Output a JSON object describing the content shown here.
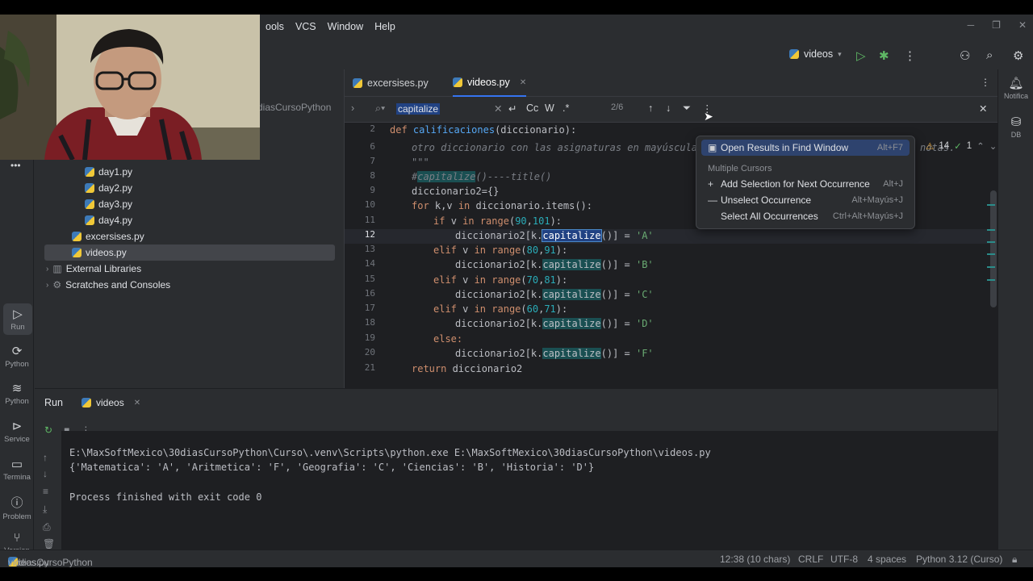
{
  "menu": [
    "ools",
    "VCS",
    "Window",
    "Help"
  ],
  "toolbar": {
    "run_config": "videos"
  },
  "tabs": [
    {
      "label": "excersises.py"
    },
    {
      "label": "videos.py"
    }
  ],
  "project": {
    "root_fragment": "diasCursoPython",
    "items": [
      {
        "label": "day1.py"
      },
      {
        "label": "day2.py"
      },
      {
        "label": "day3.py"
      },
      {
        "label": "day4.py"
      },
      {
        "label": "excersises.py"
      },
      {
        "label": "videos.py"
      },
      {
        "label": "External Libraries"
      },
      {
        "label": "Scratches and Consoles"
      }
    ]
  },
  "find": {
    "query": "capitalize",
    "match_count": "2/6",
    "case_label": "Cc",
    "word_label": "W",
    "regex_label": ".*"
  },
  "inspections": {
    "warnings": "14",
    "ok": "1"
  },
  "popup": {
    "open_results": "Open Results in Find Window",
    "open_results_shortcut": "Alt+F7",
    "section": "Multiple Cursors",
    "add_selection": "Add Selection for Next Occurrence",
    "add_selection_shortcut": "Alt+J",
    "unselect": "Unselect Occurrence",
    "unselect_shortcut": "Alt+Mayús+J",
    "select_all": "Select All Occurrences",
    "select_all_shortcut": "Ctrl+Alt+Mayús+J"
  },
  "code": {
    "line_numbers": [
      "2",
      "6",
      "7",
      "8",
      "9",
      "10",
      "11",
      "12",
      "13",
      "14",
      "15",
      "16",
      "17",
      "18",
      "19",
      "20",
      "21"
    ],
    "l2_def": "def ",
    "l2_fn": "calificaciones",
    "l2_rest": "(diccionario):",
    "l6": "otro diccionario con las asignaturas en mayúsculas y",
    "l6_tail": "notas.",
    "l7": "\"\"\"",
    "l8_hash": "#",
    "l8_word": "capitalize",
    "l8_rest": "()----title()",
    "l9": "diccionario2={}",
    "l10_for": "for ",
    "l10_a": "k,v ",
    "l10_in": "in ",
    "l10_rest": "diccionario.items():",
    "lines_if": [
      {
        "kw": "if ",
        "cond": "v ",
        "in": "in ",
        "fn": "range",
        "open": "(",
        "a": "90",
        "comma": ",",
        "b": "101",
        "close": "):"
      },
      {
        "kw": "elif ",
        "cond": "v ",
        "in": "in ",
        "fn": "range",
        "open": "(",
        "a": "80",
        "comma": ",",
        "b": "91",
        "close": "):"
      },
      {
        "kw": "elif ",
        "cond": "v ",
        "in": "in ",
        "fn": "range",
        "open": "(",
        "a": "70",
        "comma": ",",
        "b": "81",
        "close": "):"
      },
      {
        "kw": "elif ",
        "cond": "v ",
        "in": "in ",
        "fn": "range",
        "open": "(",
        "a": "60",
        "comma": ",",
        "b": "71",
        "close": "):"
      }
    ],
    "assign_pre": "diccionario2[k.",
    "assign_word": "capitalize",
    "assign_mid": "()] = ",
    "grades": [
      "'A'",
      "'B'",
      "'C'",
      "'D'",
      "'F'"
    ],
    "else": "else:",
    "return_kw": "return ",
    "return_val": "diccionario2"
  },
  "run": {
    "title": "Run",
    "tab": "videos",
    "lines": [
      "E:\\MaxSoftMexico\\30diasCursoPython\\Curso\\.venv\\Scripts\\python.exe E:\\MaxSoftMexico\\30diasCursoPython\\videos.py",
      "{'Matematica': 'A', 'Aritmetica': 'F', 'Geografia': 'C', 'Ciencias': 'B', 'Historia': 'D'}",
      "",
      "Process finished with exit code 0"
    ]
  },
  "left_tools": [
    {
      "label": "Run",
      "icon": "run-icon"
    },
    {
      "label": "Python",
      "icon": "python-console-icon"
    },
    {
      "label": "Python",
      "icon": "python-packages-icon"
    },
    {
      "label": "Service",
      "icon": "services-icon"
    },
    {
      "label": "Termina",
      "icon": "terminal-icon"
    },
    {
      "label": "Problem",
      "icon": "problems-icon"
    },
    {
      "label": "Version",
      "icon": "git-icon"
    }
  ],
  "right_tools": [
    {
      "label": "Notifica",
      "icon": "bell-icon"
    },
    {
      "label": "DB",
      "icon": "database-icon"
    }
  ],
  "status": {
    "project": "30diasCursoPython",
    "file": "videos.py",
    "position": "12:38 (10 chars)",
    "line_sep": "CRLF",
    "encoding": "UTF-8",
    "indent": "4 spaces",
    "interpreter": "Python 3.12 (Curso)"
  }
}
